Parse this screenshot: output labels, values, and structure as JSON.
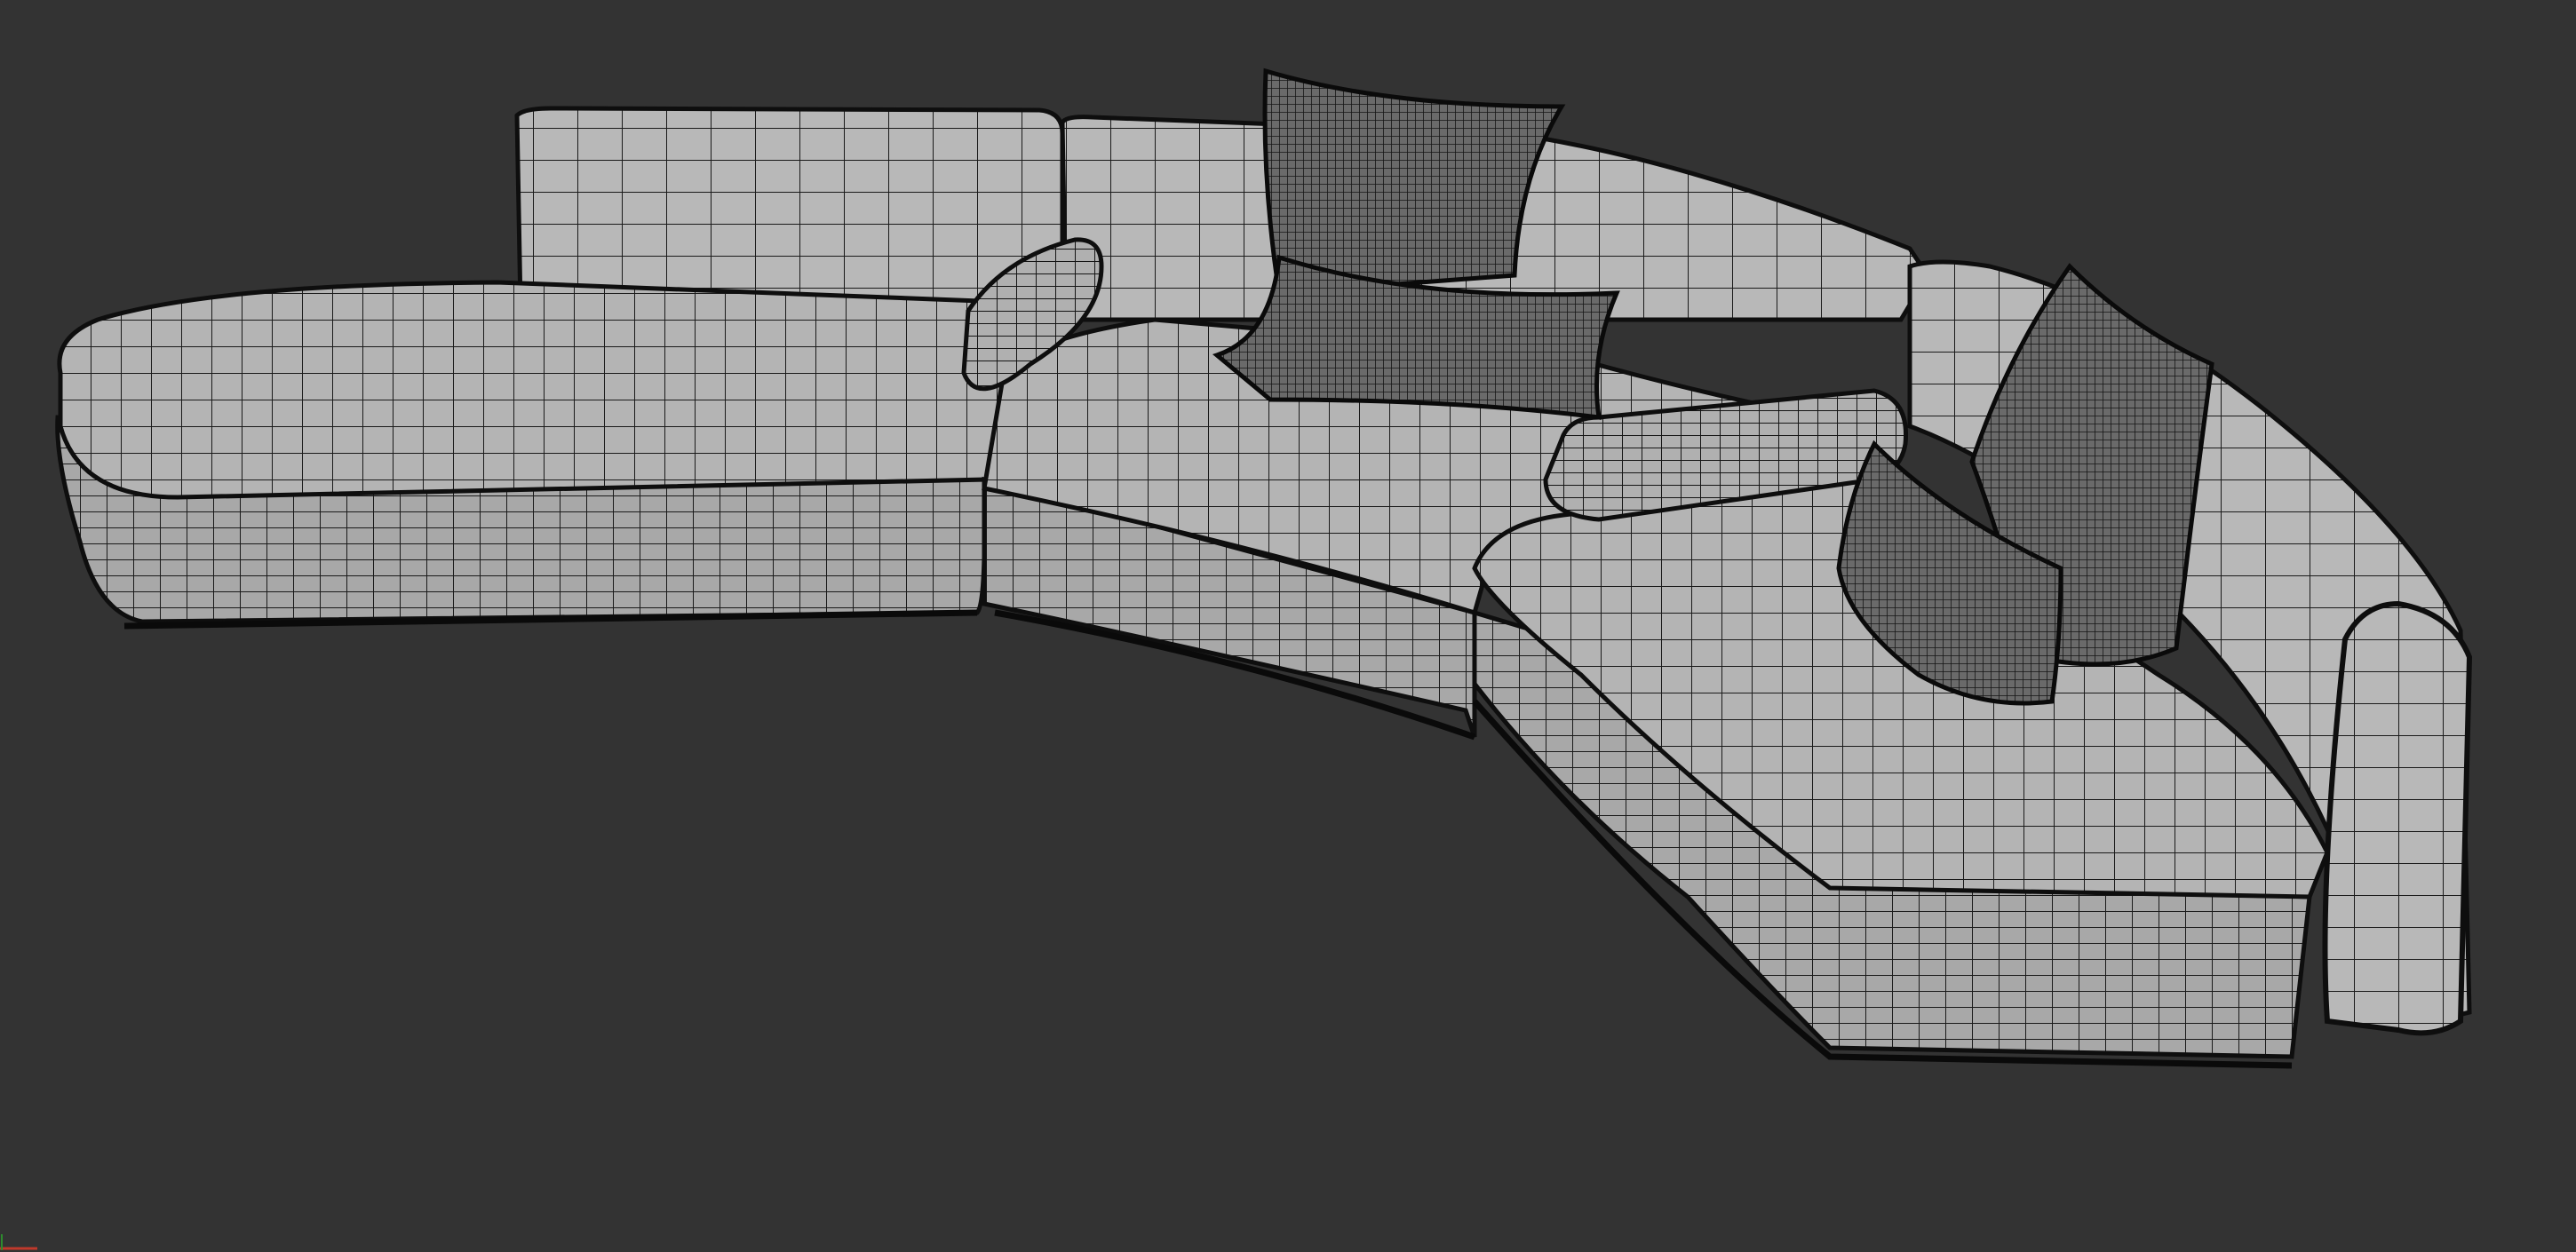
{
  "viewport": {
    "background_color": "#333333",
    "model": {
      "description_icon": "wireframe-sofa-model",
      "shading_color": "#b4b4b4",
      "wire_color": "#141414",
      "pieces": [
        "left-chaise-module",
        "center-module",
        "right-curved-module",
        "right-armrest"
      ],
      "accessories": [
        "bolster-left",
        "bolster-right",
        "pillow-back-center",
        "pillow-front-center",
        "pillow-back-right",
        "pillow-front-right"
      ]
    },
    "axis_gizmo": {
      "x_color": "#c0392b",
      "y_color": "#2e8b2e"
    }
  }
}
